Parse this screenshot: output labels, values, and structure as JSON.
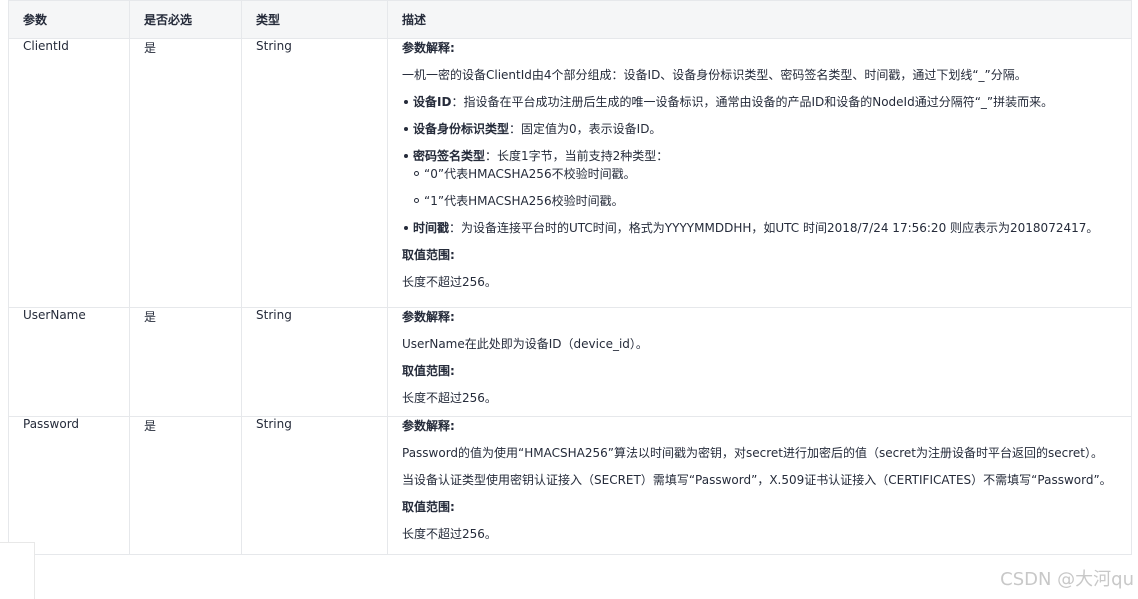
{
  "table": {
    "headers": [
      "参数",
      "是否必选",
      "类型",
      "描述"
    ],
    "rows": [
      {
        "param": "ClientId",
        "required": "是",
        "type": "String",
        "desc": {
          "explain_head": "参数解释:",
          "explain_text": "一机一密的设备ClientId由4个部分组成：设备ID、设备身份标识类型、密码签名类型、时间戳，通过下划线“_”分隔。",
          "items": [
            {
              "term": "设备ID",
              "text": "：指设备在平台成功注册后生成的唯一设备标识，通常由设备的产品ID和设备的NodeId通过分隔符“_”拼装而来。"
            },
            {
              "term": "设备身份标识类型",
              "text": "：固定值为0，表示设备ID。"
            },
            {
              "term": "密码签名类型",
              "text": "：长度1字节，当前支持2种类型："
            },
            {
              "term": "时间戳",
              "text": "：为设备连接平台时的UTC时间，格式为YYYYMMDDHH，如UTC 时间2018/7/24 17:56:20 则应表示为2018072417。"
            }
          ],
          "sub_items": [
            "“0”代表HMACSHA256不校验时间戳。",
            "“1”代表HMACSHA256校验时间戳。"
          ],
          "range_head": "取值范围:",
          "range_text": "长度不超过256。"
        }
      },
      {
        "param": "UserName",
        "required": "是",
        "type": "String",
        "desc": {
          "explain_head": "参数解释:",
          "explain_text": "UserName在此处即为设备ID（device_id）。",
          "range_head": "取值范围:",
          "range_text": "长度不超过256。"
        }
      },
      {
        "param": "Password",
        "required": "是",
        "type": "String",
        "desc": {
          "explain_head": "参数解释:",
          "explain_text": "Password的值为使用“HMACSHA256”算法以时间戳为密钥，对secret进行加密后的值（secret为注册设备时平台返回的secret）。",
          "explain_text2": "当设备认证类型使用密钥认证接入（SECRET）需填写“Password”，X.509证书认证接入（CERTIFICATES）不需填写“Password”。",
          "range_head": "取值范围:",
          "range_text": "长度不超过256。"
        }
      }
    ]
  },
  "watermark": "CSDN @大河qu"
}
